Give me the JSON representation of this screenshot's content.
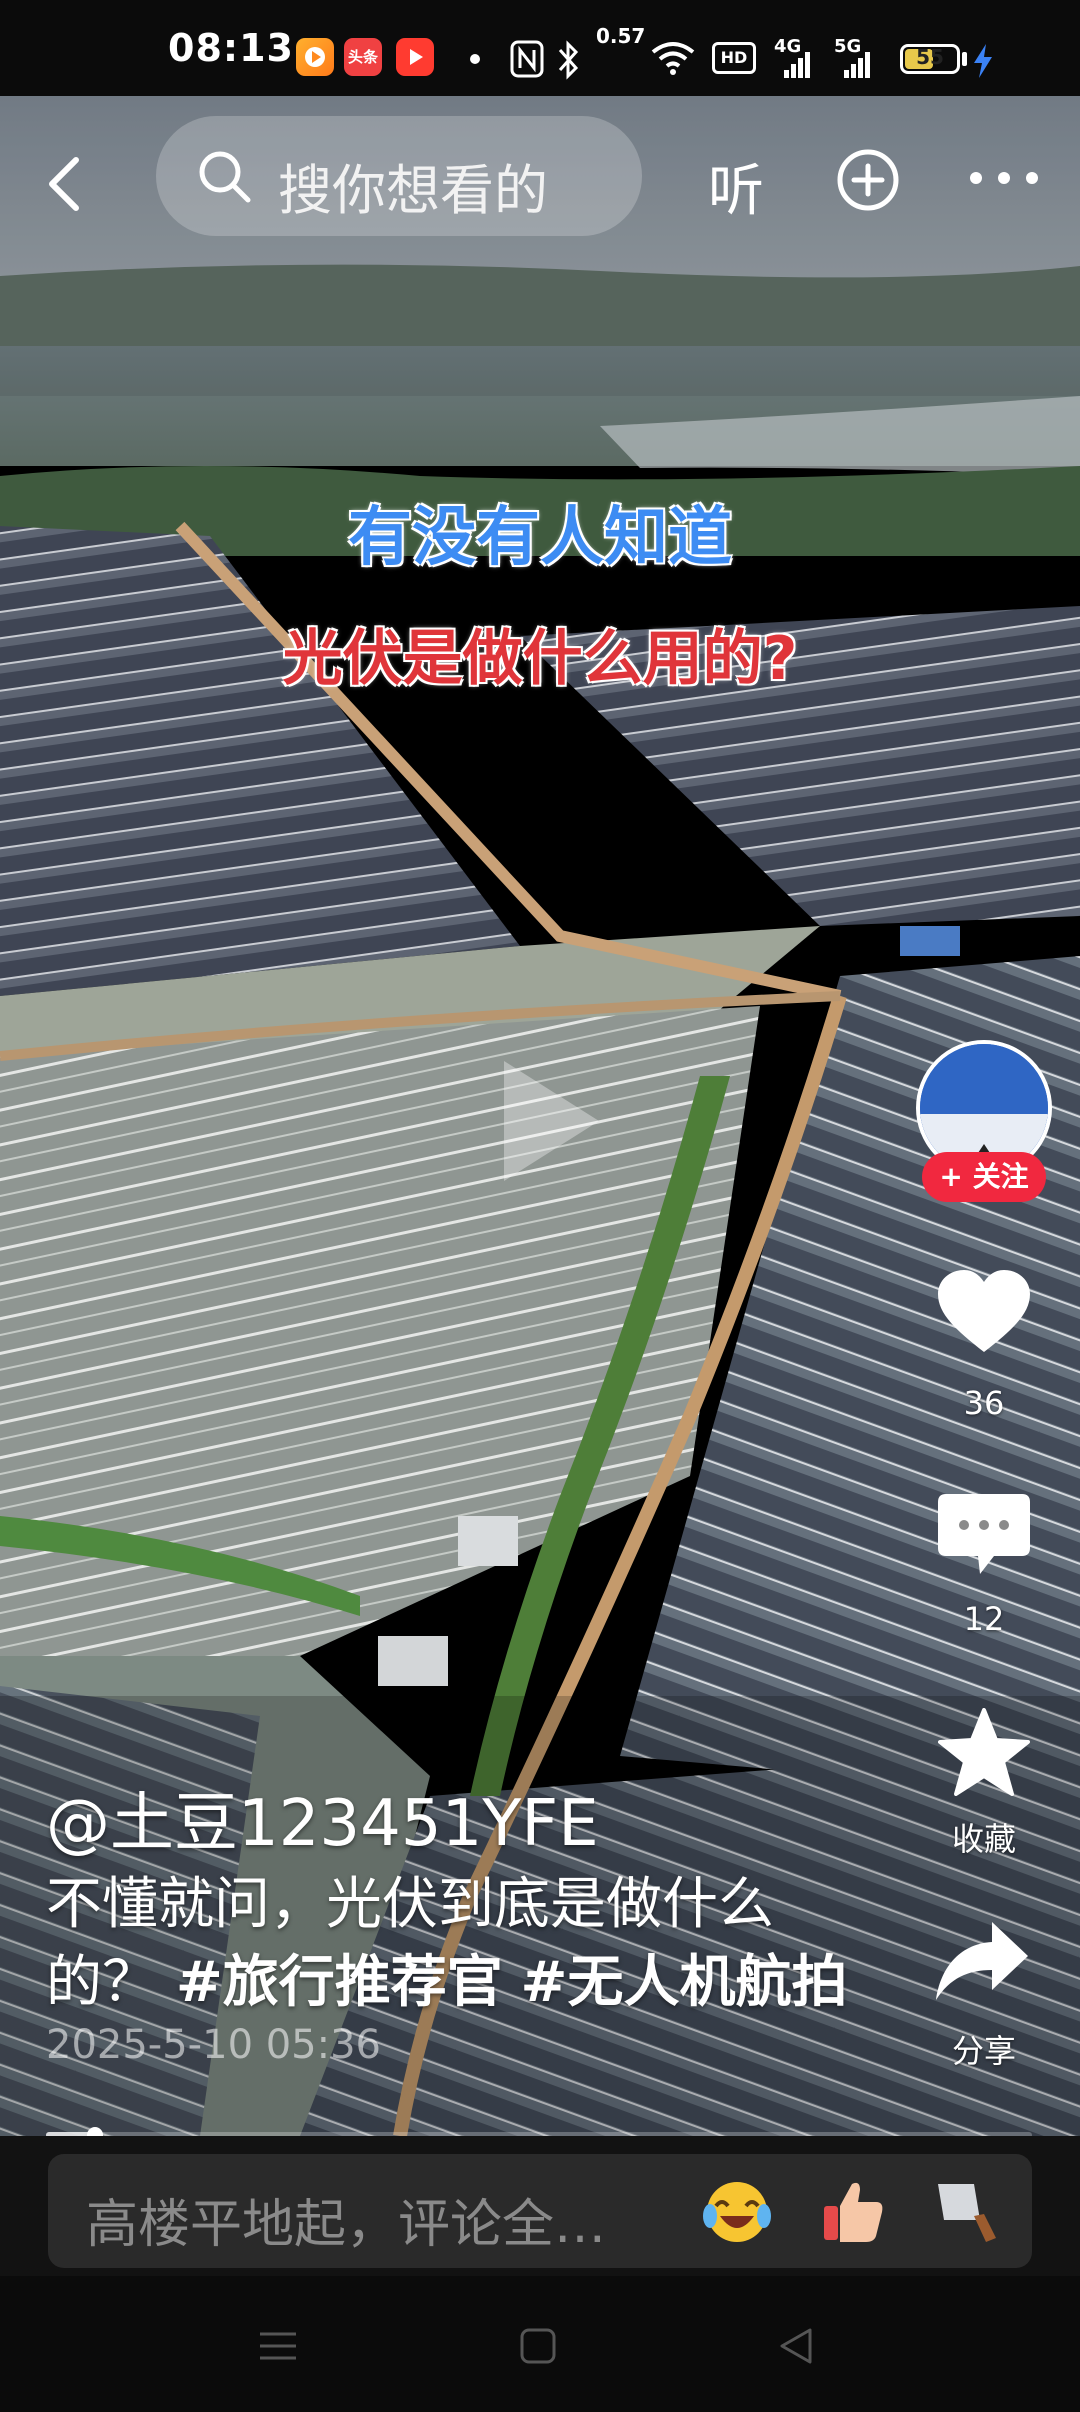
{
  "status_bar": {
    "time": "08:13",
    "app_badges": [
      "video-app-icon",
      "toutiao-icon",
      "youtube-like-icon"
    ],
    "toutiao_label": "头条",
    "speed": "0.57",
    "hd": "HD",
    "net1": "4G",
    "net2": "5G",
    "battery": "55",
    "battery_level": 0.55
  },
  "top_bar": {
    "search_placeholder": "搜你想看的",
    "listen_label": "听"
  },
  "video": {
    "caption_line1": "有没有人知道",
    "caption_line2": "光伏是做什么用的?",
    "caption_line1_color": "#3d8cf3",
    "caption_line2_color": "#e0353a",
    "progress": 0.05
  },
  "right_rail": {
    "follow_label": "+ 关注",
    "like_count": "36",
    "comment_count": "12",
    "favorite_label": "收藏",
    "share_label": "分享"
  },
  "post": {
    "author": "@土豆123451YFE",
    "description_text": "不懂就问，光伏到底是做什么的？",
    "tag1": "#旅行推荐官",
    "tag2": "#无人机航拍",
    "date": "2025-5-10 05:36"
  },
  "comment_bar": {
    "placeholder": "高楼平地起，评论全…",
    "emojis": [
      "laughing-crying-emoji",
      "thumbs-up-emoji",
      "cleaver-emoji"
    ]
  },
  "nav_bar": {
    "icons": [
      "menu-icon",
      "home-square-icon",
      "back-triangle-icon"
    ]
  },
  "colors": {
    "follow_button": "#f1283f",
    "background": "#000000"
  }
}
